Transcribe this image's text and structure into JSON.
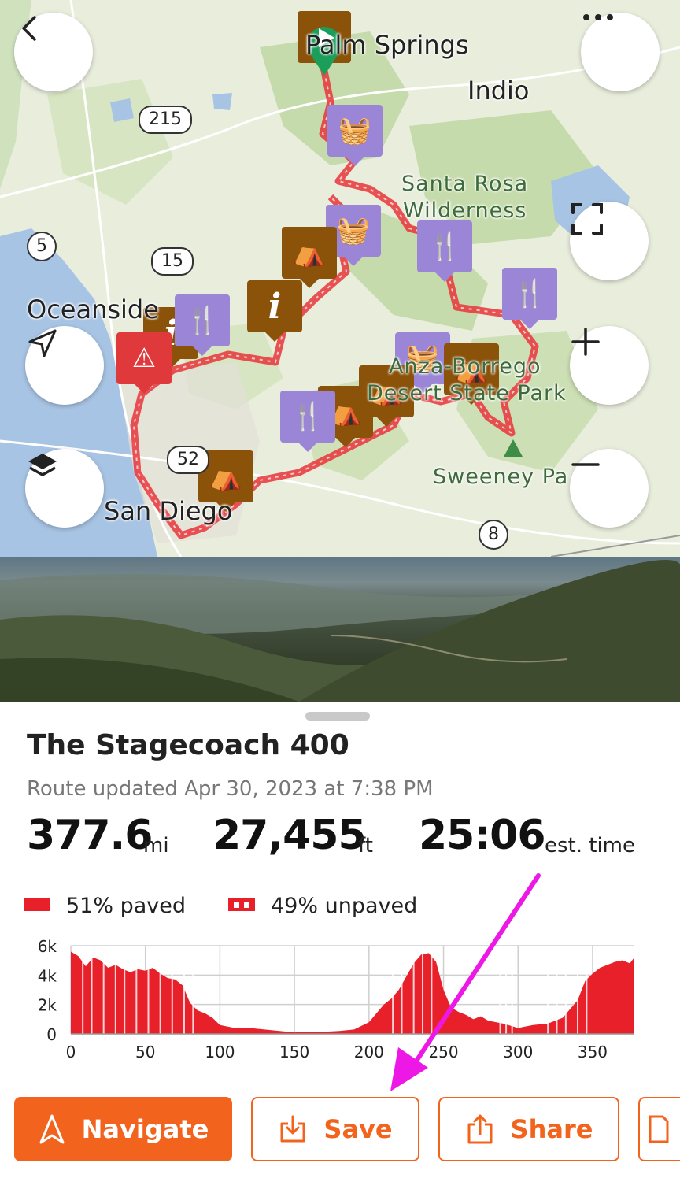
{
  "map": {
    "places": [
      "Palm Springs",
      "Indio",
      "Oceanside",
      "San Diego"
    ],
    "parks": [
      "Santa Rosa",
      "Wilderness",
      "Anza-Borrego",
      "Desert State Park",
      "Sweeney Pa"
    ],
    "highways": [
      "215",
      "5",
      "15",
      "52",
      "8"
    ],
    "controls": {
      "back_icon": "chevron-left-icon",
      "more_icon": "ellipsis-icon",
      "fullscreen_icon": "fullscreen-icon",
      "zoom_in_icon": "plus-icon",
      "zoom_out_icon": "minus-icon",
      "locate_icon": "navigation-arrow-icon",
      "layers_icon": "layers-icon"
    },
    "colors": {
      "route": "#e8353a",
      "food": "#9b85d6",
      "camp": "#8b5209",
      "warning": "#e0393c",
      "start": "#1a9e5a"
    }
  },
  "route": {
    "title": "The Stagecoach 400",
    "updated": "Route updated Apr 30, 2023 at 7:38 PM",
    "distance": {
      "value": "377.6",
      "unit": "mi"
    },
    "elevation": {
      "value": "27,455",
      "unit": "ft"
    },
    "time": {
      "value": "25:06",
      "unit": "est. time"
    },
    "surface": {
      "paved_label": "51% paved",
      "unpaved_label": "49% unpaved",
      "paved_color": "#e8202a"
    }
  },
  "chart_data": {
    "type": "area",
    "title": "",
    "xlabel": "",
    "ylabel": "",
    "xlim": [
      0,
      378
    ],
    "ylim": [
      0,
      6000
    ],
    "x_ticks": [
      "0",
      "50",
      "100",
      "150",
      "200",
      "250",
      "300",
      "350"
    ],
    "y_ticks": [
      "0",
      "2k",
      "4k",
      "6k"
    ],
    "grid": true,
    "series": [
      {
        "x": [
          0,
          5,
          10,
          15,
          20,
          25,
          30,
          35,
          40,
          45,
          50,
          55,
          60,
          65,
          70,
          75,
          80,
          85,
          90,
          95,
          100,
          110,
          120,
          130,
          140,
          150,
          160,
          170,
          180,
          190,
          200,
          205,
          210,
          215,
          220,
          225,
          230,
          235,
          240,
          245,
          250,
          255,
          260,
          265,
          270,
          275,
          280,
          290,
          300,
          310,
          320,
          330,
          335,
          340,
          345,
          350,
          355,
          360,
          365,
          370,
          375,
          378
        ],
        "y": [
          5600,
          5300,
          4600,
          5200,
          5000,
          4500,
          4700,
          4400,
          4200,
          4400,
          4300,
          4500,
          4100,
          3800,
          3700,
          3300,
          2100,
          1600,
          1400,
          1100,
          600,
          400,
          400,
          300,
          200,
          100,
          150,
          150,
          200,
          300,
          800,
          1400,
          2000,
          2400,
          3000,
          3900,
          4800,
          5400,
          5500,
          4900,
          3000,
          1800,
          1500,
          1300,
          1000,
          1200,
          900,
          700,
          400,
          600,
          700,
          1100,
          1700,
          2300,
          3600,
          4100,
          4500,
          4700,
          4900,
          5000,
          4800,
          5200
        ]
      }
    ]
  },
  "actions": {
    "navigate": "Navigate",
    "save": "Save",
    "share": "Share"
  }
}
